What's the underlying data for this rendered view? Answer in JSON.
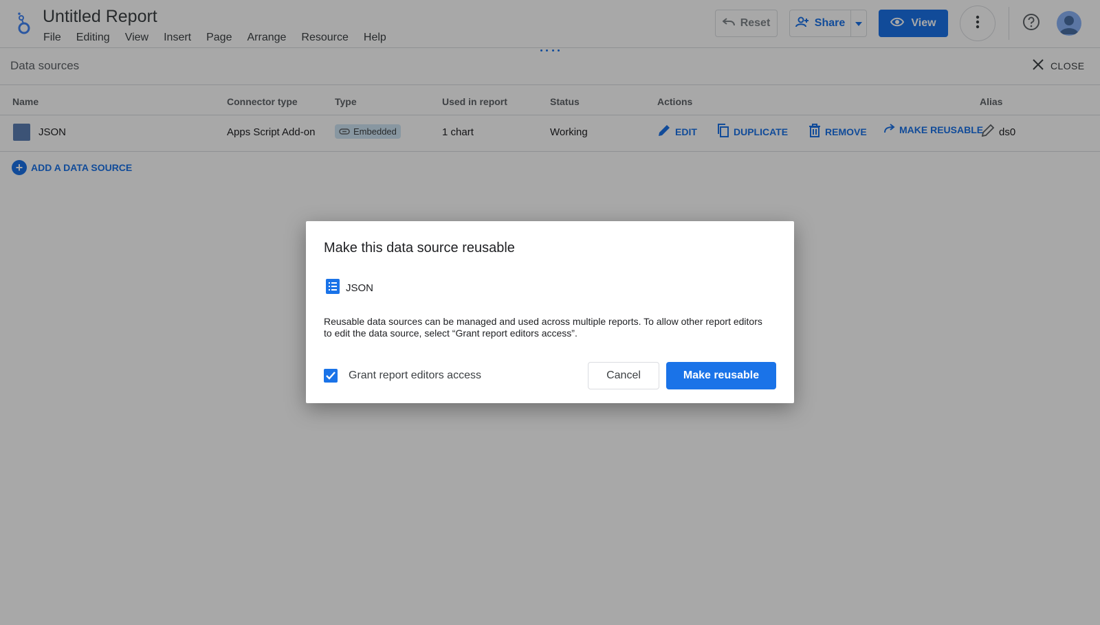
{
  "app": {
    "title": "Untitled Report",
    "logo_icon": "looker-studio-logo-icon"
  },
  "menu": [
    "File",
    "Editing",
    "View",
    "Insert",
    "Page",
    "Arrange",
    "Resource",
    "Help"
  ],
  "toolbar": {
    "reset_label": "Reset",
    "share_label": "Share",
    "view_label": "View"
  },
  "panel": {
    "title": "Data sources",
    "close_label": "CLOSE"
  },
  "table": {
    "columns": [
      "Name",
      "Connector type",
      "Type",
      "Used in report",
      "Status",
      "Actions",
      "Alias"
    ],
    "rows": [
      {
        "name": "JSON",
        "connector_type": "Apps Script Add-on",
        "type": "Embedded",
        "used_in_report": "1 chart",
        "status": "Working",
        "actions": [
          "EDIT",
          "DUPLICATE",
          "REMOVE",
          "MAKE REUSABLE"
        ],
        "alias": "ds0"
      }
    ]
  },
  "add_source_label": "ADD A DATA SOURCE",
  "dialog": {
    "title": "Make this data source reusable",
    "source_name": "JSON",
    "description": "Reusable data sources can be managed and used across multiple reports. To allow other report editors to edit the data source, select “Grant report editors access”.",
    "checkbox_label": "Grant report editors access",
    "checkbox_checked": true,
    "cancel_label": "Cancel",
    "confirm_label": "Make reusable"
  },
  "colors": {
    "accent": "#1a73e8",
    "scrim": "rgba(0,0,0,0.34)",
    "source_square": "#5b7fb4",
    "chip_bg": "#cfe5f5"
  }
}
